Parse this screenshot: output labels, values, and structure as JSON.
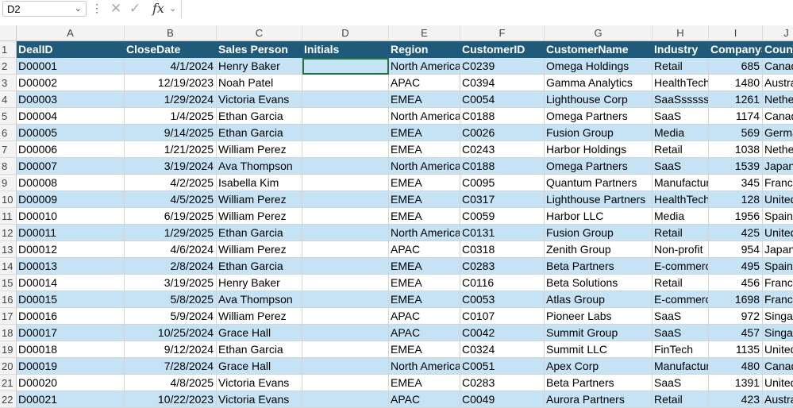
{
  "formula_bar": {
    "name_box": "D2",
    "dots": "⋮",
    "cancel_icon": "✕",
    "enter_icon": "✓",
    "fx": "fx",
    "fx_chevron": "⌄",
    "formula": ""
  },
  "columns": [
    "A",
    "B",
    "C",
    "D",
    "E",
    "F",
    "G",
    "H",
    "I",
    "J"
  ],
  "header": [
    "DealID",
    "CloseDate",
    "Sales Person",
    "Initials",
    "Region",
    "CustomerID",
    "CustomerName",
    "Industry",
    "CompanySize",
    "Country"
  ],
  "rows": [
    [
      "D00001",
      "4/1/2024",
      "Henry Baker",
      "",
      "North America",
      "C0239",
      "Omega Holdings",
      "Retail",
      "685",
      "Canada"
    ],
    [
      "D00002",
      "12/19/2023",
      "Noah Patel",
      "",
      "APAC",
      "C0394",
      "Gamma Analytics",
      "HealthTech",
      "1480",
      "Australia"
    ],
    [
      "D00003",
      "1/29/2024",
      "Victoria Evans",
      "",
      "EMEA",
      "C0054",
      "Lighthouse Corp",
      "SaaSsssss",
      "1261",
      "Netherlands"
    ],
    [
      "D00004",
      "1/4/2025",
      "Ethan Garcia",
      "",
      "North America",
      "C0188",
      "Omega Partners",
      "SaaS",
      "1174",
      "Canada"
    ],
    [
      "D00005",
      "9/14/2025",
      "Ethan Garcia",
      "",
      "EMEA",
      "C0026",
      "Fusion Group",
      "Media",
      "569",
      "Germany"
    ],
    [
      "D00006",
      "1/21/2025",
      "William Perez",
      "",
      "EMEA",
      "C0243",
      "Harbor Holdings",
      "Retail",
      "1038",
      "Netherlands"
    ],
    [
      "D00007",
      "3/19/2024",
      "Ava Thompson",
      "",
      "North America",
      "C0188",
      "Omega Partners",
      "SaaS",
      "1539",
      "Japan"
    ],
    [
      "D00008",
      "4/2/2025",
      "Isabella Kim",
      "",
      "EMEA",
      "C0095",
      "Quantum Partners",
      "Manufacturing",
      "345",
      "France"
    ],
    [
      "D00009",
      "4/5/2025",
      "William Perez",
      "",
      "EMEA",
      "C0317",
      "Lighthouse Partners",
      "HealthTech",
      "128",
      "United States"
    ],
    [
      "D00010",
      "6/19/2025",
      "William Perez",
      "",
      "EMEA",
      "C0059",
      "Harbor LLC",
      "Media",
      "1956",
      "Spain"
    ],
    [
      "D00011",
      "1/29/2025",
      "Ethan Garcia",
      "",
      "North America",
      "C0131",
      "Fusion Group",
      "Retail",
      "425",
      "United States"
    ],
    [
      "D00012",
      "4/6/2024",
      "William Perez",
      "",
      "APAC",
      "C0318",
      "Zenith Group",
      "Non-profit",
      "954",
      "Japan"
    ],
    [
      "D00013",
      "2/8/2024",
      "Ethan Garcia",
      "",
      "EMEA",
      "C0283",
      "Beta Partners",
      "E-commerce",
      "495",
      "Spain"
    ],
    [
      "D00014",
      "3/19/2025",
      "Henry Baker",
      "",
      "EMEA",
      "C0116",
      "Beta Solutions",
      "Retail",
      "456",
      "France"
    ],
    [
      "D00015",
      "5/8/2025",
      "Ava Thompson",
      "",
      "EMEA",
      "C0053",
      "Atlas Group",
      "E-commerce",
      "1698",
      "France"
    ],
    [
      "D00016",
      "5/9/2024",
      "William Perez",
      "",
      "APAC",
      "C0107",
      "Pioneer Labs",
      "SaaS",
      "972",
      "Singapore"
    ],
    [
      "D00017",
      "10/25/2024",
      "Grace Hall",
      "",
      "APAC",
      "C0042",
      "Summit Group",
      "SaaS",
      "457",
      "Singapore"
    ],
    [
      "D00018",
      "9/12/2024",
      "Ethan Garcia",
      "",
      "EMEA",
      "C0324",
      "Summit LLC",
      "FinTech",
      "1135",
      "United States"
    ],
    [
      "D00019",
      "7/28/2024",
      "Grace Hall",
      "",
      "North America",
      "C0051",
      "Apex Corp",
      "Manufacturing",
      "480",
      "Canada"
    ],
    [
      "D00020",
      "4/8/2025",
      "Victoria Evans",
      "",
      "EMEA",
      "C0283",
      "Beta Partners",
      "SaaS",
      "1391",
      "United States"
    ],
    [
      "D00021",
      "10/22/2023",
      "Victoria Evans",
      "",
      "APAC",
      "C0049",
      "Aurora Partners",
      "Retail",
      "423",
      "Australia"
    ]
  ],
  "colors": {
    "header_fill": "#1f5a7a",
    "band_fill": "#c5e3f5",
    "selection": "#217346"
  }
}
